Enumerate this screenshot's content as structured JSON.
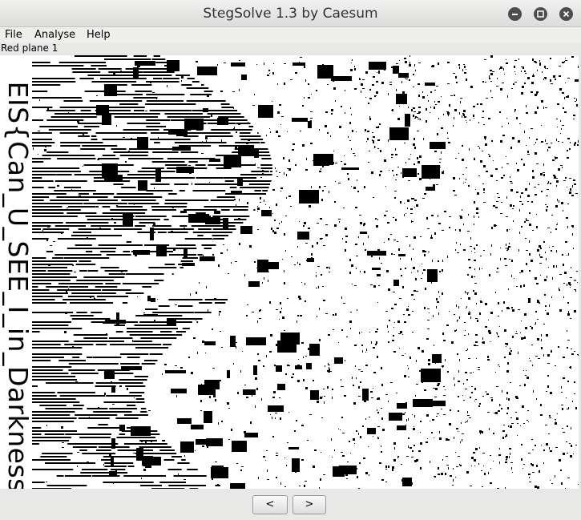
{
  "window": {
    "title": "StegSolve 1.3 by Caesum"
  },
  "window_controls": [
    "minimize-icon",
    "maximize-icon",
    "close-icon"
  ],
  "menu": {
    "items": [
      "File",
      "Analyse",
      "Help"
    ]
  },
  "viewer": {
    "plane_label": "Red plane 1",
    "embedded_text": "EIS{Can_U_SEE_I_in_Darkness}"
  },
  "navigation": {
    "prev_label": "<",
    "next_label": ">"
  },
  "colors": {
    "title_text": "#2e3436",
    "window_button": "#4a4e51",
    "background": "#e8e8e7"
  }
}
